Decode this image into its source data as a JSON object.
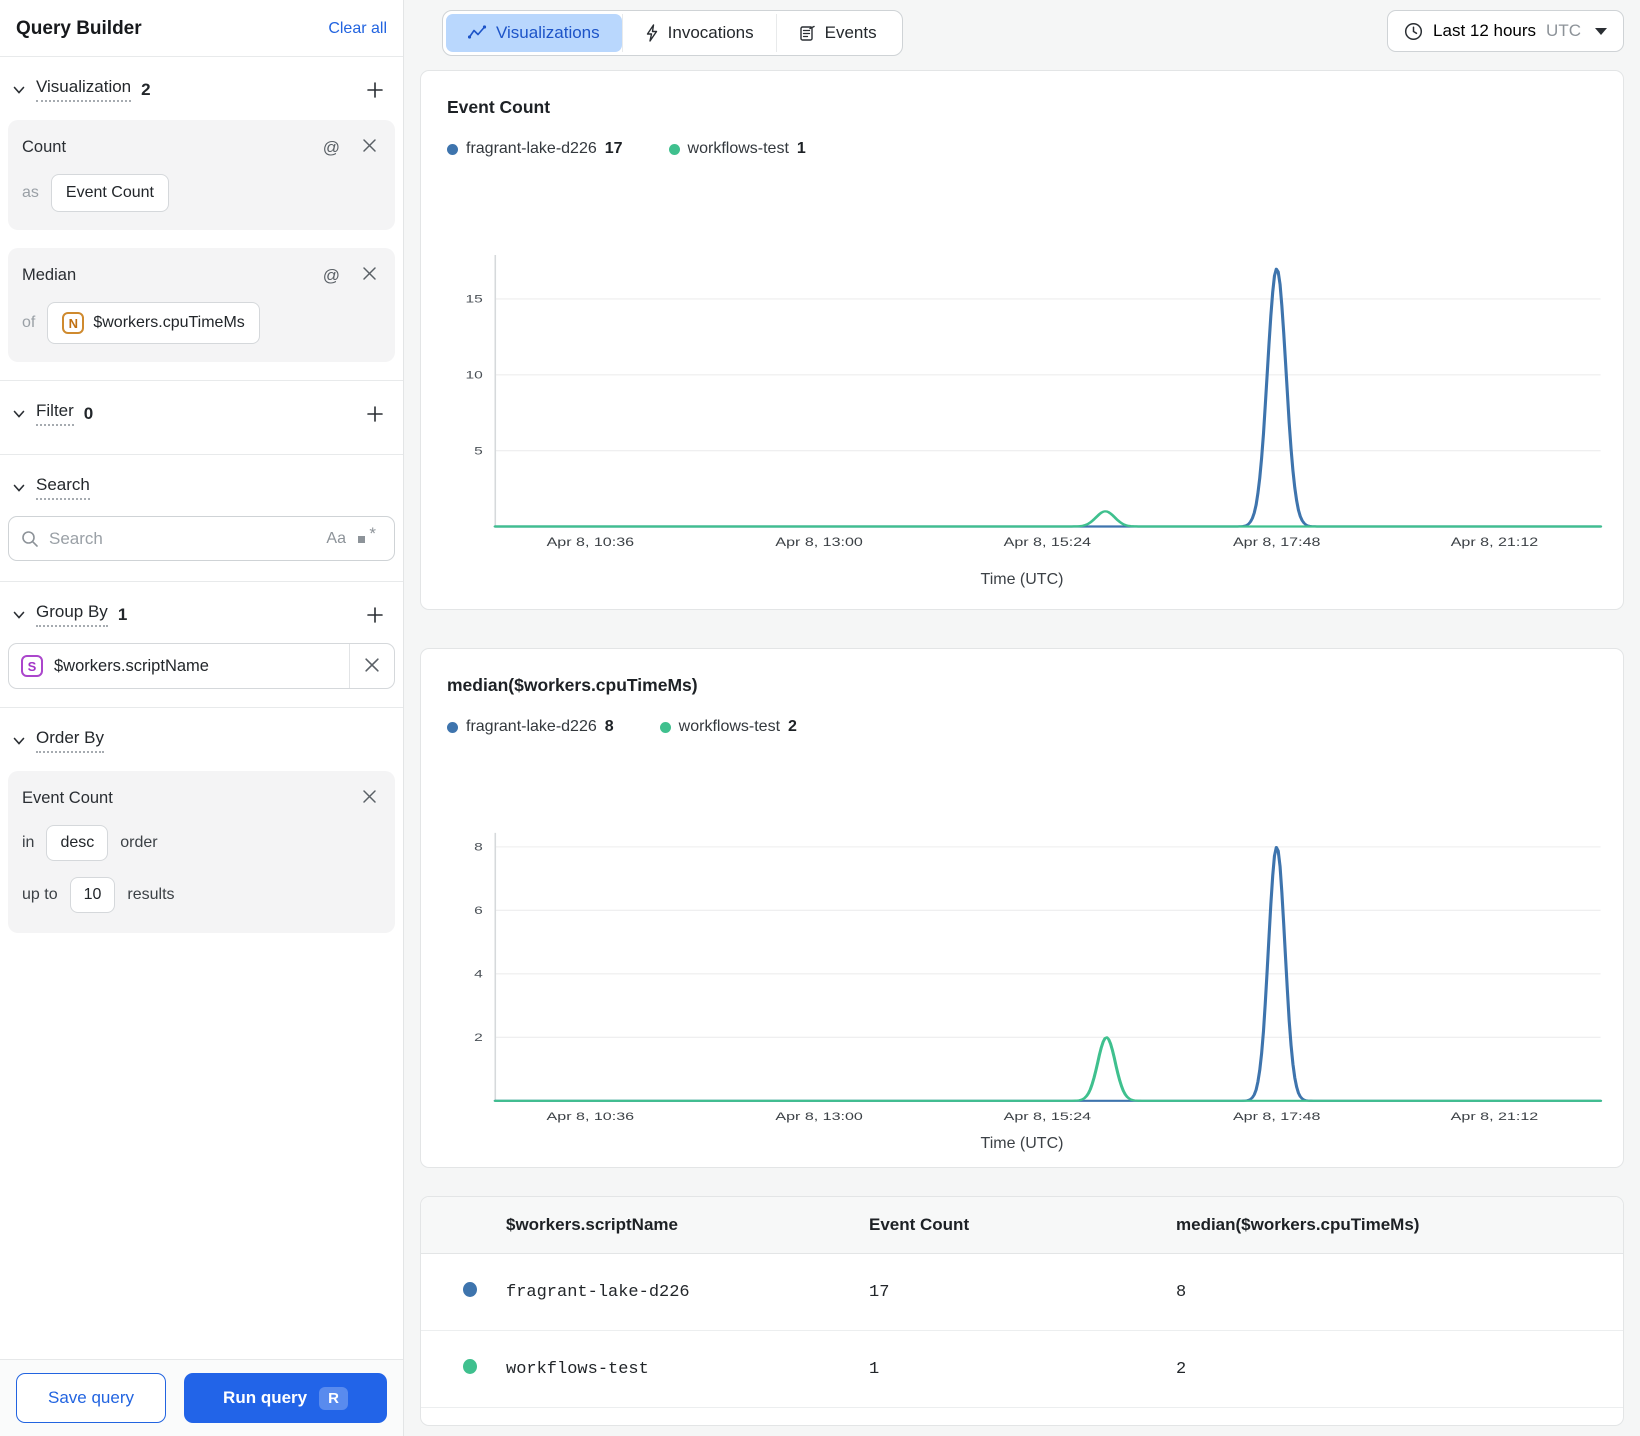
{
  "sidebar": {
    "title": "Query Builder",
    "clear_all_label": "Clear all",
    "visualization": {
      "label": "Visualization",
      "count": "2",
      "cards": [
        {
          "title": "Count",
          "prefix": "as",
          "value": "Event Count"
        },
        {
          "title": "Median",
          "prefix": "of",
          "value": "$workers.cpuTimeMs",
          "type_icon": "N"
        }
      ]
    },
    "filter": {
      "label": "Filter",
      "count": "0"
    },
    "search": {
      "label": "Search",
      "placeholder": "Search",
      "match_case_icon": "Aa",
      "regex_icon": ".*"
    },
    "group_by": {
      "label": "Group By",
      "count": "1",
      "value": "$workers.scriptName",
      "type_icon": "S"
    },
    "order_by": {
      "label": "Order By",
      "field": "Event Count",
      "in_label": "in",
      "direction": "desc",
      "order_label": "order",
      "up_to_label": "up to",
      "limit": "10",
      "results_label": "results"
    },
    "save_button": "Save query",
    "run_button": "Run query",
    "run_shortcut": "R"
  },
  "topbar": {
    "tabs": [
      {
        "label": "Visualizations",
        "active": true
      },
      {
        "label": "Invocations",
        "active": false
      },
      {
        "label": "Events",
        "active": false
      }
    ],
    "time_range": {
      "label": "Last 12 hours",
      "timezone": "UTC"
    }
  },
  "colors": {
    "series_blue": "#3e74ad",
    "series_green": "#3fc08e",
    "accent_blue": "#2264e8",
    "active_tab_bg": "#b9d7fd",
    "active_tab_text": "#1d54c8"
  },
  "chart_data": [
    {
      "type": "line",
      "title": "Event Count",
      "xlabel": "Time (UTC)",
      "ylim": [
        0,
        17.6
      ],
      "yticks": [
        5,
        10,
        15
      ],
      "grid": true,
      "legend_position": "top",
      "x_ticks": [
        {
          "label": "Apr 8, 10:36",
          "f": 0.086
        },
        {
          "label": "Apr 8, 13:00",
          "f": 0.293
        },
        {
          "label": "Apr 8, 15:24",
          "f": 0.4995
        },
        {
          "label": "Apr 8, 17:48",
          "f": 0.707
        },
        {
          "label": "Apr 8, 21:12",
          "f": 0.904
        }
      ],
      "legend": [
        {
          "name": "fragrant-lake-d226",
          "value": "17",
          "color": "#3e74ad"
        },
        {
          "name": "workflows-test",
          "value": "1",
          "color": "#3fc08e"
        }
      ],
      "series": [
        {
          "name": "fragrant-lake-d226",
          "color": "#3e74ad",
          "baseline": 0,
          "peaks": [
            {
              "center": 0.707,
              "halfwidth": 0.018,
              "value": 17,
              "peak_time": "Apr 8, 17:48"
            }
          ]
        },
        {
          "name": "workflows-test",
          "color": "#3fc08e",
          "baseline": 0,
          "peaks": [
            {
              "center": 0.552,
              "halfwidth": 0.018,
              "value": 1,
              "peak_time": "Apr 8, ~16:00"
            }
          ]
        }
      ]
    },
    {
      "type": "line",
      "title": "median($workers.cpuTimeMs)",
      "xlabel": "Time (UTC)",
      "ylim": [
        0,
        8.3
      ],
      "yticks": [
        2,
        4,
        6,
        8
      ],
      "grid": true,
      "legend_position": "top",
      "x_ticks": [
        {
          "label": "Apr 8, 10:36",
          "f": 0.086
        },
        {
          "label": "Apr 8, 13:00",
          "f": 0.293
        },
        {
          "label": "Apr 8, 15:24",
          "f": 0.4995
        },
        {
          "label": "Apr 8, 17:48",
          "f": 0.707
        },
        {
          "label": "Apr 8, 21:12",
          "f": 0.904
        }
      ],
      "legend": [
        {
          "name": "fragrant-lake-d226",
          "value": "8",
          "color": "#3e74ad"
        },
        {
          "name": "workflows-test",
          "value": "2",
          "color": "#3fc08e"
        }
      ],
      "series": [
        {
          "name": "fragrant-lake-d226",
          "color": "#3e74ad",
          "baseline": 0,
          "peaks": [
            {
              "center": 0.707,
              "halfwidth": 0.016,
              "value": 8,
              "peak_time": "Apr 8, 17:48"
            }
          ]
        },
        {
          "name": "workflows-test",
          "color": "#3fc08e",
          "baseline": 0,
          "peaks": [
            {
              "center": 0.553,
              "halfwidth": 0.017,
              "value": 2,
              "peak_time": "Apr 8, ~16:00"
            }
          ]
        }
      ]
    },
    {
      "type": "table",
      "columns": [
        "$workers.scriptName",
        "Event Count",
        "median($workers.cpuTimeMs)"
      ],
      "rows": [
        {
          "name": "fragrant-lake-d226",
          "event_count": "17",
          "median": "8",
          "color": "#3e74ad"
        },
        {
          "name": "workflows-test",
          "event_count": "1",
          "median": "2",
          "color": "#3fc08e"
        }
      ]
    }
  ],
  "table": {
    "headers": {
      "script_name": "$workers.scriptName",
      "event_count": "Event Count",
      "median": "median($workers.cpuTimeMs)"
    },
    "rows": [
      {
        "name": "fragrant-lake-d226",
        "event_count": "17",
        "median": "8",
        "color": "#3e74ad"
      },
      {
        "name": "workflows-test",
        "event_count": "1",
        "median": "2",
        "color": "#3fc08e"
      }
    ]
  }
}
